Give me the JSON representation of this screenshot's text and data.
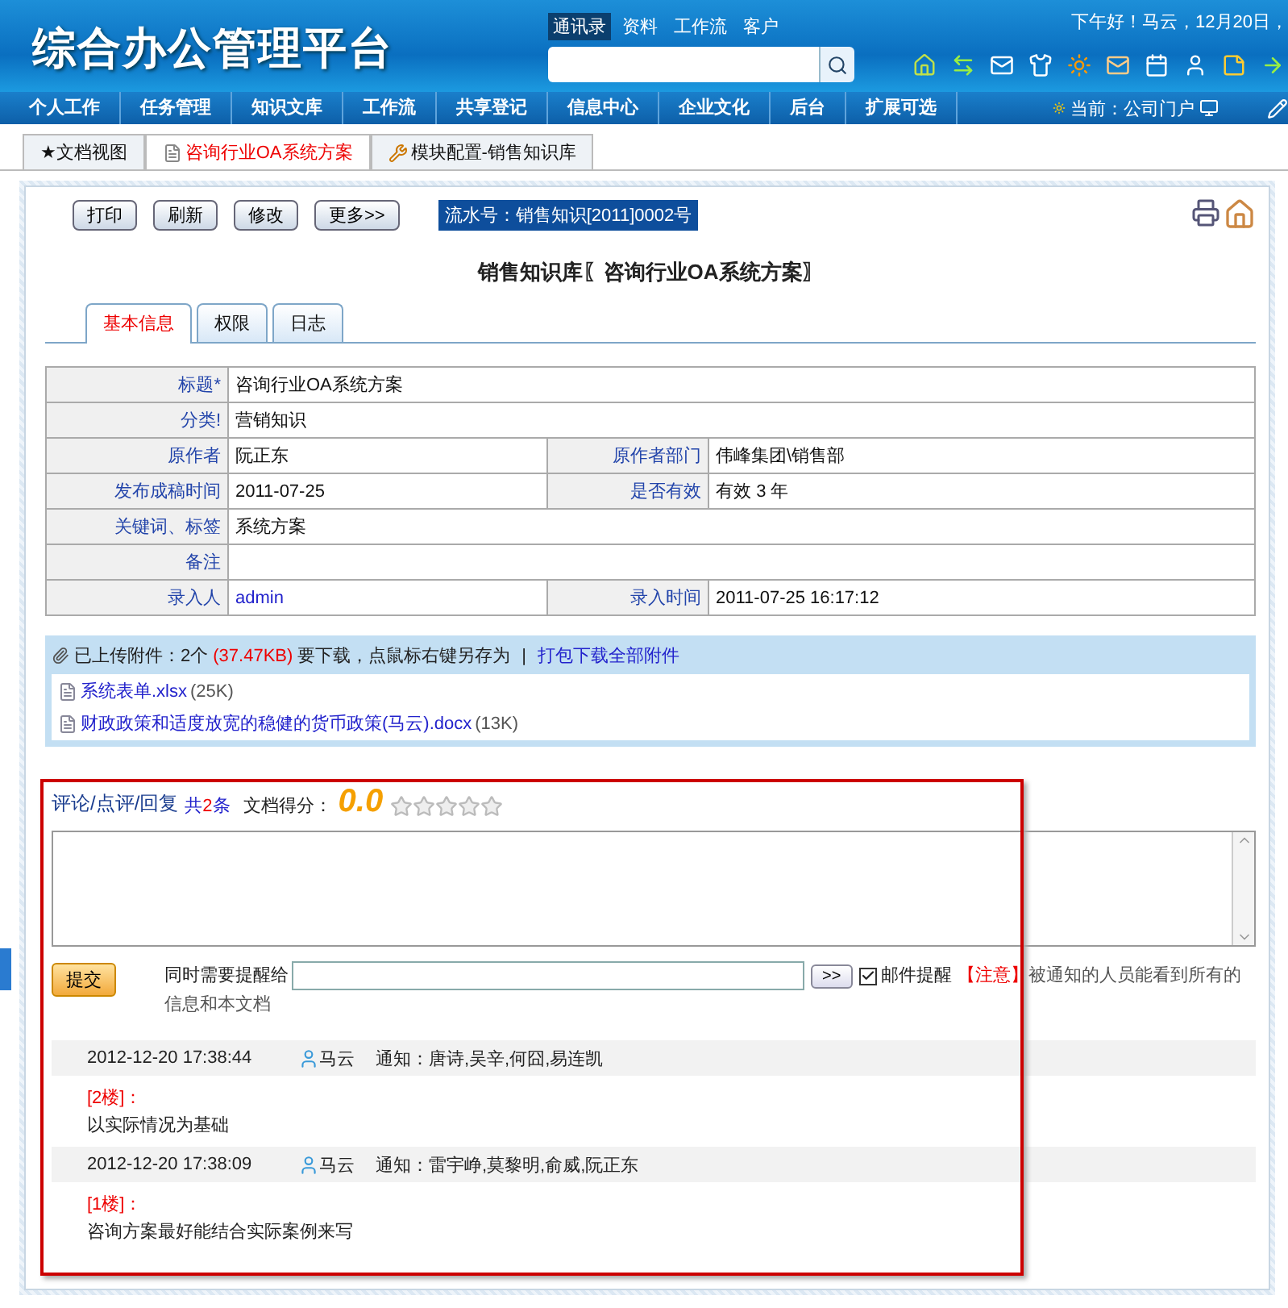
{
  "header": {
    "logo": "综合办公管理平台",
    "search_tabs": [
      {
        "label": "通讯录",
        "selected": true
      },
      {
        "label": "资料",
        "selected": false
      },
      {
        "label": "工作流",
        "selected": false
      },
      {
        "label": "客户",
        "selected": false
      }
    ],
    "greeting": "下午好！马云，12月20日，"
  },
  "nav": {
    "items": [
      "个人工作",
      "任务管理",
      "知识文库",
      "工作流",
      "共享登记",
      "信息中心",
      "企业文化",
      "后台",
      "扩展可选"
    ],
    "current": "当前：公司门户"
  },
  "page_tabs": [
    {
      "label": "★文档视图",
      "selected": false,
      "kind": "plain"
    },
    {
      "label": "咨询行业OA系统方案",
      "selected": true,
      "kind": "document"
    },
    {
      "label": "模块配置-销售知识库",
      "selected": false,
      "kind": "tools"
    }
  ],
  "toolbar": {
    "buttons": [
      "打印",
      "刷新",
      "修改",
      "更多>>"
    ],
    "serial": "流水号：销售知识[2011]0002号"
  },
  "title": "销售知识库〖咨询行业OA系统方案〗",
  "sub_tabs": [
    {
      "label": "基本信息",
      "selected": true
    },
    {
      "label": "权限",
      "selected": false
    },
    {
      "label": "日志",
      "selected": false
    }
  ],
  "fields": [
    [
      {
        "label": "标题*",
        "value": "咨询行业OA系统方案"
      }
    ],
    [
      {
        "label": "分类!",
        "value": "营销知识"
      }
    ],
    [
      {
        "label": "原作者",
        "value": "阮正东"
      },
      {
        "label": "原作者部门",
        "value": "伟峰集团\\销售部"
      }
    ],
    [
      {
        "label": "发布成稿时间",
        "value": "2011-07-25"
      },
      {
        "label": "是否有效",
        "value": "有效  3 年"
      }
    ],
    [
      {
        "label": "关键词、标签",
        "value": "系统方案"
      }
    ],
    [
      {
        "label": "备注"
      }
    ],
    [
      {
        "label": "录入人",
        "value": "admin",
        "link": true
      },
      {
        "label": "录入时间",
        "value": "2011-07-25 16:17:12"
      }
    ]
  ],
  "attachments": {
    "summary": "已上传附件：2个",
    "size": "(37.47KB)",
    "hint": "要下载，点鼠标右键另存为",
    "separator": "|",
    "download_all": "打包下载全部附件",
    "files": [
      {
        "name": "系统表单.xlsx",
        "size": "(25K)"
      },
      {
        "name": "财政政策和适度放宽的稳健的货币政策(马云).docx",
        "size": "(13K)"
      }
    ]
  },
  "comments": {
    "title": "评论/点评/回复",
    "count_prefix": "共",
    "count": "2",
    "count_suffix": "条",
    "score_label": "文档得分：",
    "score": "0.0",
    "stars": 0,
    "submit": "提交",
    "notify_label": "同时需要提醒给",
    "add_button": ">>",
    "email_notify": {
      "label": "邮件提醒",
      "checked": true
    },
    "note_tag": "【注意】",
    "note": [
      "被通知的人员能看到所有的",
      "信息和本文档"
    ],
    "entries": [
      {
        "time": "2012-12-20 17:38:44",
        "user": "马云",
        "notify": "通知：唐诗,吴辛,何囧,易连凯",
        "floor": "[2楼]：",
        "text": "以实际情况为基础"
      },
      {
        "time": "2012-12-20 17:38:09",
        "user": "马云",
        "notify": "通知：雷宇峥,莫黎明,俞威,阮正东",
        "floor": "[1楼]：",
        "text": "咨询方案最好能结合实际案例来写"
      }
    ]
  }
}
